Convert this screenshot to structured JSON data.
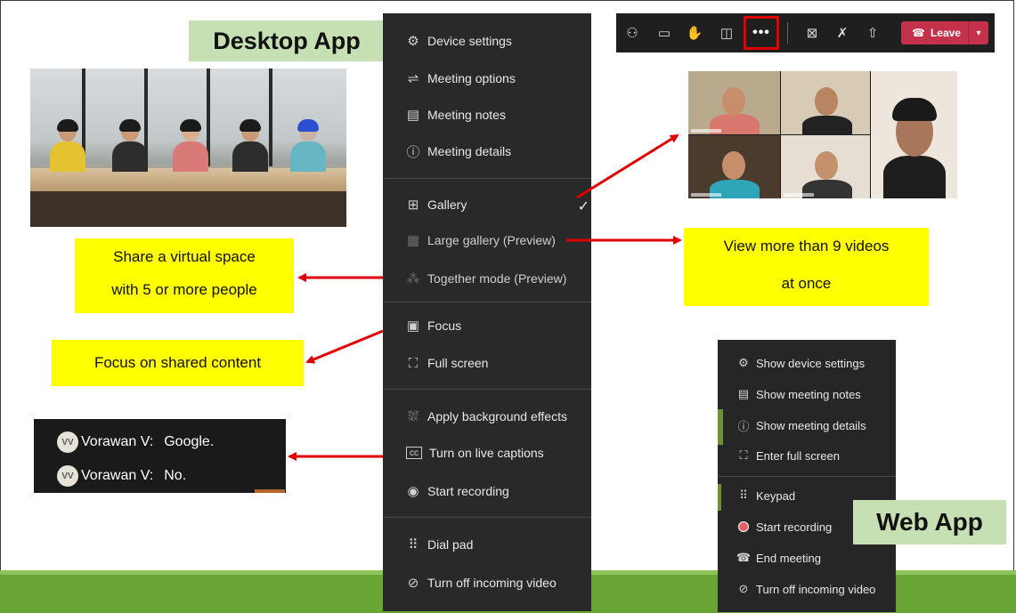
{
  "labels": {
    "desktop_app": "Desktop App",
    "web_app": "Web App"
  },
  "callouts": {
    "share_line1": "Share a virtual space",
    "share_line2": "with 5 or more people",
    "large_line1": "View more than 9 videos",
    "large_line2": "at once",
    "focus": "Focus on shared content"
  },
  "desktop_menu": {
    "items": [
      {
        "icon": "gear-icon",
        "label": "Device settings"
      },
      {
        "icon": "sliders-icon",
        "label": "Meeting options"
      },
      {
        "icon": "notes-icon",
        "label": "Meeting notes"
      },
      {
        "icon": "info-icon",
        "label": "Meeting details"
      },
      {
        "icon": "gallery-icon",
        "label": "Gallery",
        "checked": true
      },
      {
        "icon": "large-gallery-icon",
        "label": "Large gallery (Preview)"
      },
      {
        "icon": "together-mode-icon",
        "label": "Together mode (Preview)"
      },
      {
        "icon": "focus-icon",
        "label": "Focus"
      },
      {
        "icon": "fullscreen-icon",
        "label": "Full screen"
      },
      {
        "icon": "background-effects-icon",
        "label": "Apply background effects"
      },
      {
        "icon": "captions-icon",
        "label": "Turn on live captions"
      },
      {
        "icon": "record-icon",
        "label": "Start recording"
      },
      {
        "icon": "dial-pad-icon",
        "label": "Dial pad"
      },
      {
        "icon": "video-off-icon",
        "label": "Turn off incoming video"
      }
    ]
  },
  "toolbar": {
    "icons": [
      "participants-icon",
      "chat-icon",
      "raise-hand-icon",
      "rooms-icon",
      "more-actions-icon",
      "camera-off-icon",
      "mic-off-icon",
      "share-screen-icon"
    ],
    "more_label": "•••",
    "leave_label": "Leave",
    "accent_color": "#c4314b",
    "highlight_color": "#e00000"
  },
  "captions": {
    "rows": [
      {
        "initials": "VV",
        "speaker": "Vorawan V:",
        "text": "Google."
      },
      {
        "initials": "VV",
        "speaker": "Vorawan V:",
        "text": "No."
      }
    ]
  },
  "web_menu": {
    "items": [
      {
        "icon": "gear-icon",
        "label": "Show device settings"
      },
      {
        "icon": "notes-icon",
        "label": "Show meeting notes"
      },
      {
        "icon": "info-icon",
        "label": "Show meeting details"
      },
      {
        "icon": "fullscreen-icon",
        "label": "Enter full screen"
      },
      {
        "icon": "keypad-icon",
        "label": "Keypad"
      },
      {
        "icon": "record-icon",
        "label": "Start recording"
      },
      {
        "icon": "end-call-icon",
        "label": "End meeting"
      },
      {
        "icon": "video-off-icon",
        "label": "Turn off incoming video"
      }
    ]
  },
  "colors": {
    "callout_bg": "#ffff00",
    "label_bg": "#c6e0b4",
    "arrow": "#e00000",
    "footer_green": "#69a534"
  }
}
